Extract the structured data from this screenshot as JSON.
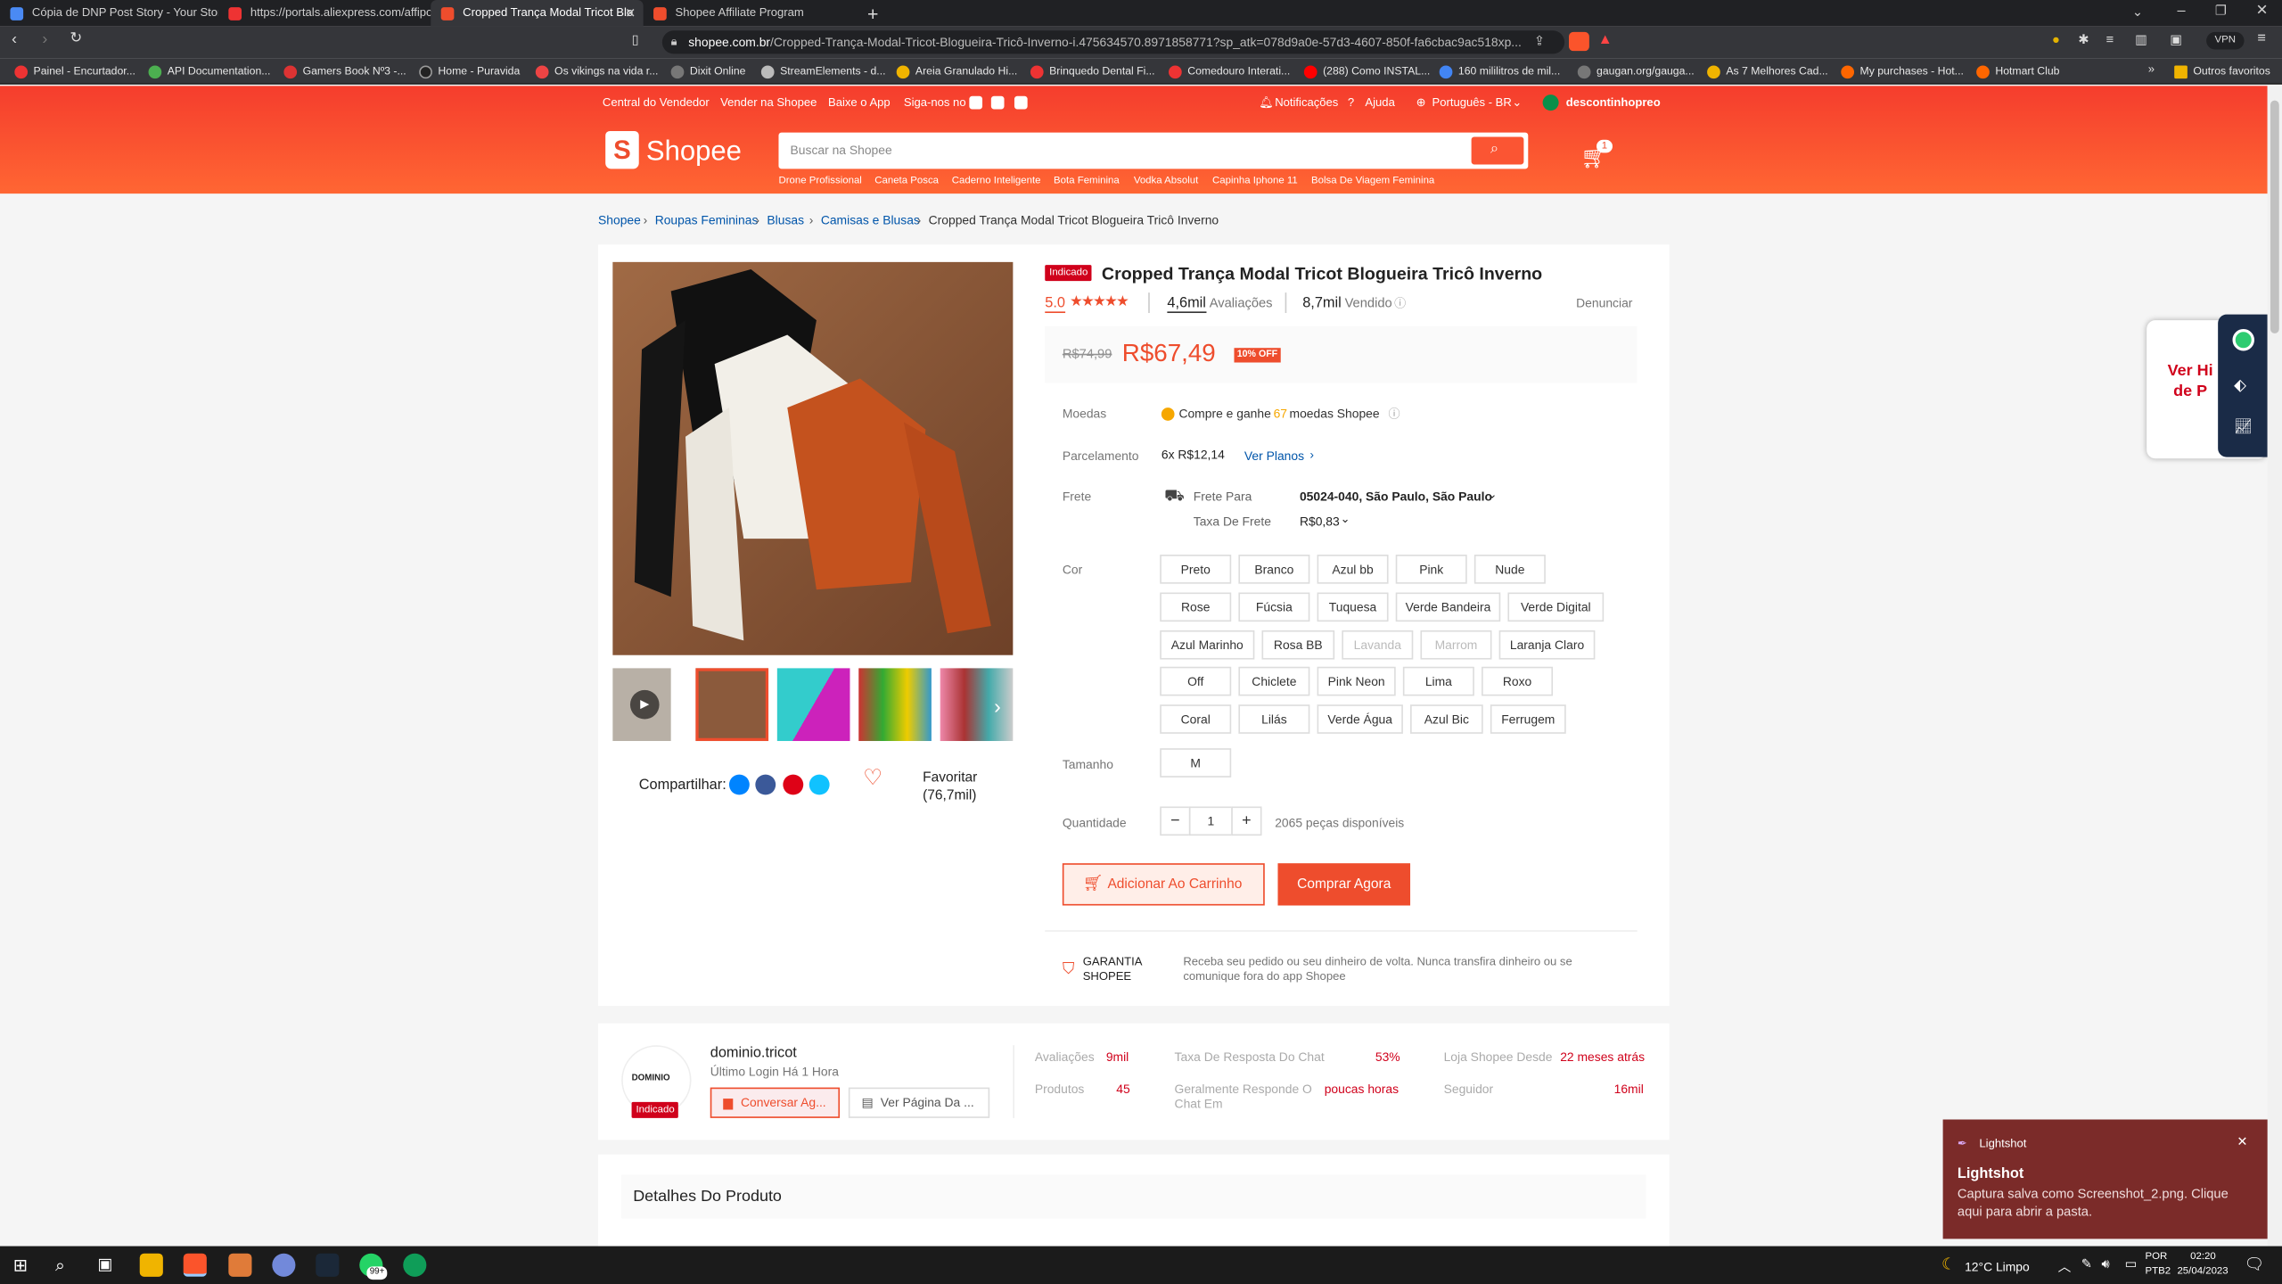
{
  "browser": {
    "tabs": [
      {
        "title": "Cópia de DNP Post Story - Your Story",
        "active": false
      },
      {
        "title": "https://portals.aliexpress.com/affiport",
        "active": false
      },
      {
        "title": "Cropped Trança Modal Tricot Blo",
        "active": true
      },
      {
        "title": "Shopee Affiliate Program",
        "active": false
      }
    ],
    "new_tab": "+",
    "url_host": "shopee.com.br",
    "url_path": "/Cropped-Trança-Modal-Tricot-Blogueira-Tricô-Inverno-i.475634570.8971858771?sp_atk=078d9a0e-57d3-4607-850f-fa6cbac9ac518xp...",
    "vpn": "VPN",
    "bookmarks": [
      "Painel - Encurtador...",
      "API Documentation...",
      "Gamers Book Nº3 -...",
      "Home - Puravida",
      "Os vikings na vida r...",
      "Dixit Online",
      "StreamElements - d...",
      "Areia Granulado Hi...",
      "Brinquedo Dental Fi...",
      "Comedouro Interati...",
      "(288) Como INSTAL...",
      "160 mililitros de mil...",
      "gaugan.org/gauga...",
      "As 7 Melhores Cad...",
      "My purchases - Hot...",
      "Hotmart Club"
    ],
    "other_favorites": "Outros favoritos"
  },
  "header": {
    "top_left": [
      "Central do Vendedor",
      "Vender na Shopee",
      "Baixe o App",
      "Siga-nos no"
    ],
    "notifications": "Notificações",
    "help": "Ajuda",
    "language": "Português - BR",
    "user": "descontinhopreo",
    "logo": "Shopee",
    "search_placeholder": "Buscar na Shopee",
    "cart_count": "1",
    "suggestions": [
      "Drone Profissional",
      "Caneta Posca",
      "Caderno Inteligente",
      "Bota Feminina",
      "Vodka Absolut",
      "Capinha Iphone 11",
      "Bolsa De Viagem Feminina"
    ]
  },
  "breadcrumb": [
    "Shopee",
    "Roupas Femininas",
    "Blusas",
    "Camisas e Blusas",
    "Cropped Trança Modal Tricot Blogueira Tricô Inverno"
  ],
  "product": {
    "badge": "Indicado",
    "title": "Cropped Trança Modal Tricot Blogueira Tricô Inverno",
    "rating": "5.0",
    "stars": 5,
    "reviews_count": "4,6mil",
    "reviews_label": "Avaliações",
    "sold_count": "8,7mil",
    "sold_label": "Vendido",
    "report": "Denunciar",
    "old_price": "R$74,99",
    "price": "R$67,49",
    "discount": "10% OFF",
    "coins_label": "Moedas",
    "coins_text_a": "Compre e ganhe",
    "coins_value": "67",
    "coins_text_b": "moedas Shopee",
    "installment_label": "Parcelamento",
    "installment_value": "6x R$12,14",
    "installment_link": "Ver Planos",
    "shipping_label": "Frete",
    "shipping_to_label": "Frete Para",
    "shipping_to_value": "05024-040, São Paulo, São Paulo",
    "shipping_fee_label": "Taxa De Frete",
    "shipping_fee_value": "R$0,83",
    "color_label": "Cor",
    "colors": [
      {
        "name": "Preto",
        "disabled": false
      },
      {
        "name": "Branco",
        "disabled": false
      },
      {
        "name": "Azul bb",
        "disabled": false
      },
      {
        "name": "Pink",
        "disabled": false
      },
      {
        "name": "Nude",
        "disabled": false
      },
      {
        "name": "Rose",
        "disabled": false
      },
      {
        "name": "Fúcsia",
        "disabled": false
      },
      {
        "name": "Tuquesa",
        "disabled": false
      },
      {
        "name": "Verde Bandeira",
        "disabled": false
      },
      {
        "name": "Verde Digital",
        "disabled": false
      },
      {
        "name": "Azul Marinho",
        "disabled": false
      },
      {
        "name": "Rosa BB",
        "disabled": false
      },
      {
        "name": "Lavanda",
        "disabled": true
      },
      {
        "name": "Marrom",
        "disabled": true
      },
      {
        "name": "Laranja Claro",
        "disabled": false
      },
      {
        "name": "Off",
        "disabled": false
      },
      {
        "name": "Chiclete",
        "disabled": false
      },
      {
        "name": "Pink Neon",
        "disabled": false
      },
      {
        "name": "Lima",
        "disabled": false
      },
      {
        "name": "Roxo",
        "disabled": false
      },
      {
        "name": "Coral",
        "disabled": false
      },
      {
        "name": "Lilás",
        "disabled": false
      },
      {
        "name": "Verde Água",
        "disabled": false
      },
      {
        "name": "Azul Bic",
        "disabled": false
      },
      {
        "name": "Ferrugem",
        "disabled": false
      }
    ],
    "size_label": "Tamanho",
    "size_value": "M",
    "qty_label": "Quantidade",
    "qty_value": "1",
    "stock": "2065 peças disponíveis",
    "add_to_cart": "Adicionar Ao Carrinho",
    "buy_now": "Comprar Agora",
    "guarantee_title": "GARANTIA SHOPEE",
    "guarantee_text": "Receba seu pedido ou seu dinheiro de volta. Nunca transfira dinheiro ou se comunique fora do app Shopee",
    "share_label": "Compartilhar:",
    "favorite_label": "Favoritar",
    "favorite_count": "(76,7mil)"
  },
  "shop": {
    "name": "dominio.tricot",
    "logo_text": "DOMINIO",
    "last_login": "Último Login Há 1 Hora",
    "badge": "Indicado",
    "chat_button": "Conversar Ag...",
    "page_button": "Ver Página Da ...",
    "stats": [
      {
        "label": "Avaliações",
        "value": "9mil"
      },
      {
        "label": "Taxa De Resposta Do Chat",
        "value": "53%"
      },
      {
        "label": "Loja Shopee Desde",
        "value": "22 meses atrás"
      },
      {
        "label": "Produtos",
        "value": "45"
      },
      {
        "label": "Geralmente Responde O Chat Em",
        "value": "poucas horas"
      },
      {
        "label": "Seguidor",
        "value": "16mil"
      }
    ]
  },
  "details_title": "Detalhes Do Produto",
  "side_widget": {
    "text": "Ver Hi de P"
  },
  "toast": {
    "app": "Lightshot",
    "title": "Lightshot",
    "message": "Captura salva como Screenshot_2.png. Clique aqui para abrir a pasta."
  },
  "taskbar": {
    "weather": "12°C  Limpo",
    "lang": "POR",
    "lang2": "PTB2",
    "time": "02:20",
    "date": "25/04/2023",
    "badge": "99+"
  },
  "colors": {
    "brand": "#ee4d2d",
    "header_gradient_top": "#f53d2d",
    "header_gradient_bottom": "#ff6633",
    "taskbar": "#1b1b1b"
  }
}
